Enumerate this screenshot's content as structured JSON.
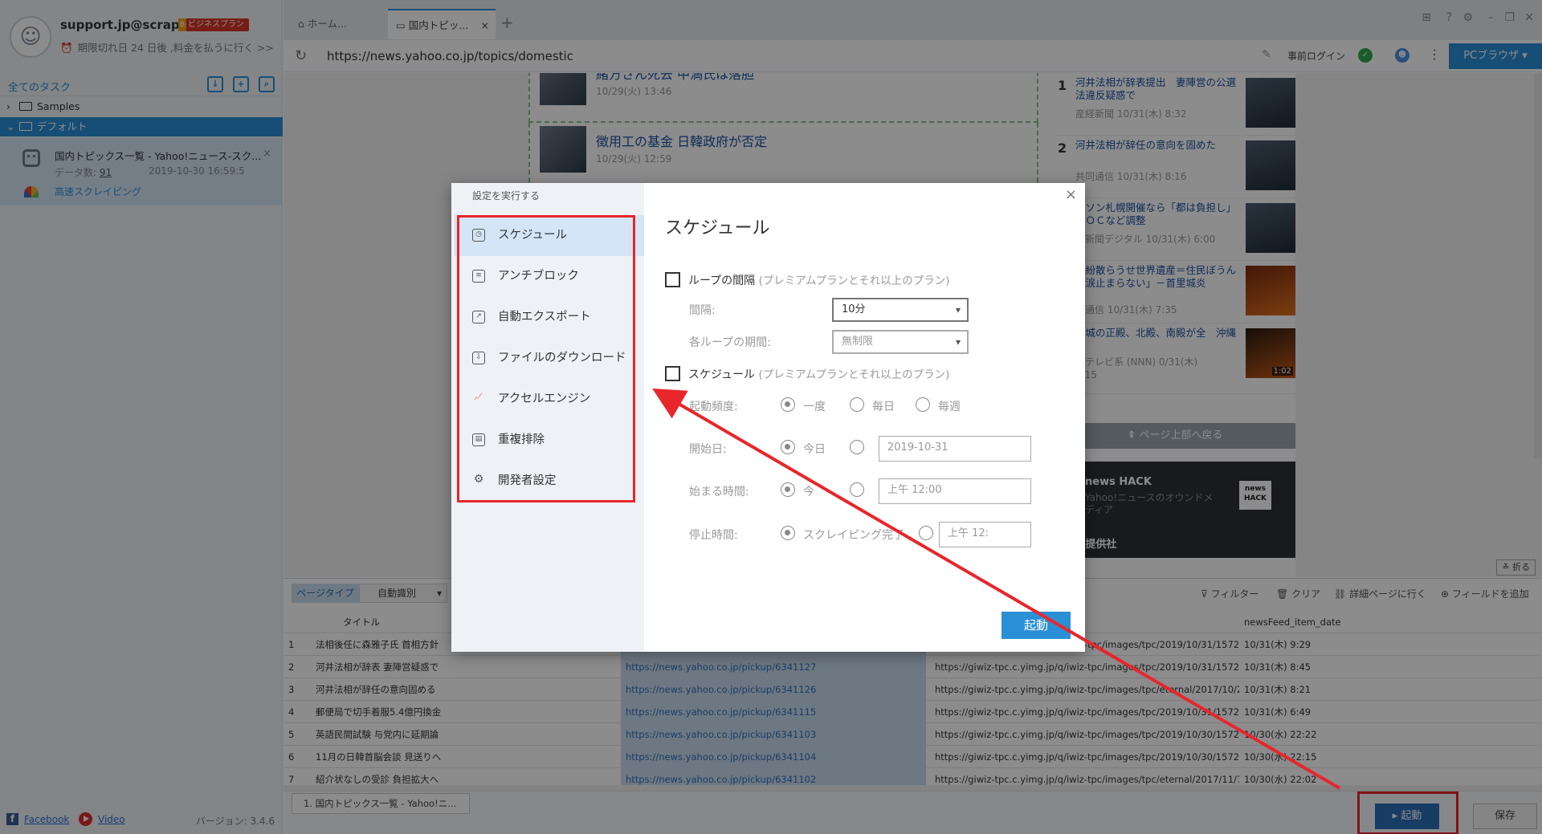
{
  "account": {
    "name": "support.jp@scrap...",
    "plan_badge": "ビジネスプラン",
    "expire_notice": "期限切れ日 24 日後 ,料金を払うに行く >>"
  },
  "tasks": {
    "all_label": "全てのタスク",
    "folders": [
      "Samples",
      "デフォルト"
    ],
    "item": {
      "title": "国内トピックス一覧 - Yahoo!ニュース-スク...",
      "count_label": "データ数: ",
      "count": "91",
      "date": "2019-10-30 16:59:5",
      "speed_label": "高速スクレイピング"
    }
  },
  "footer": {
    "facebook": "Facebook",
    "video": "Video",
    "version": "バージョン: 3.4.6"
  },
  "browser": {
    "tabs": [
      "ホーム...",
      "国内トピッ..."
    ],
    "url": "https://news.yahoo.co.jp/topics/domestic",
    "prelogin": "事前ログイン",
    "pc_browser": "PCブラウザ"
  },
  "news": [
    {
      "title": "緒方さん死去 中満氏は落胆",
      "date": "10/29(火) 13:46"
    },
    {
      "title": "徴用工の基金 日韓政府が否定",
      "date": "10/29(火) 12:59"
    }
  ],
  "ranking": [
    {
      "no": "1",
      "title": "河井法相が辞表提出　妻陣営の公選法違反疑惑で",
      "source": "産経新聞 10/31(木) 8:32"
    },
    {
      "no": "2",
      "title": "河井法相が辞任の意向を固めた",
      "source": "共同通信 10/31(木) 8:16"
    },
    {
      "no": "",
      "title": "ラソン札幌開催なら「都は負担し」 ＩＯＣなど調整",
      "source": "日新聞デジタル 10/31(木) 6:00"
    },
    {
      "no": "",
      "title": "の紛散らうせ世界遺産＝住民ぼうん「涙止まらない」－首里城炎",
      "source": "事通信 10/31(木) 7:35"
    },
    {
      "no": "",
      "title": "里城の正殿、北殿、南殿が全　沖縄",
      "source": "本テレビ系 (NNN) 0/31(木) 7:15",
      "badge": "1:02"
    }
  ],
  "back_top": "ページ上部へ戻る",
  "newshack": {
    "title": "news HACK",
    "sub": "Yahoo!ニュースのオウンドメディア",
    "logo": "news HACK",
    "provider": "ュース提供社"
  },
  "panel": {
    "collapse": "折る",
    "tab_pagetype": "ページタイプ",
    "tab_auto": "自動識別",
    "tools": [
      "フィルター",
      "クリア",
      "詳細ページに行く",
      "フィールドを追加"
    ],
    "columns": [
      "",
      "タイトル",
      "",
      "",
      "newsFeed_item_date"
    ],
    "rows": [
      [
        "1",
        "法相後任に森雅子氏 首相方針",
        "",
        "https://giwiz-tpc.c.yimg.jp/q/iwiz-tpc/images/tpc/2019/10/31/157248...",
        "10/31(木) 9:29"
      ],
      [
        "2",
        "河井法相が辞表 妻陣営疑惑で",
        "https://news.yahoo.co.jp/pickup/6341127",
        "https://giwiz-tpc.c.yimg.jp/q/iwiz-tpc/images/tpc/2019/10/31/157247...",
        "10/31(木) 8:45"
      ],
      [
        "3",
        "河井法相が辞任の意向固める",
        "https://news.yahoo.co.jp/pickup/6341126",
        "https://giwiz-tpc.c.yimg.jp/q/iwiz-tpc/images/tpc/eternal/2017/10/27/...",
        "10/31(木) 8:21"
      ],
      [
        "4",
        "郵便局で切手着服5.4億円換金",
        "https://news.yahoo.co.jp/pickup/6341115",
        "https://giwiz-tpc.c.yimg.jp/q/iwiz-tpc/images/tpc/2019/10/31/157247...",
        "10/31(木) 6:49"
      ],
      [
        "5",
        "英語民間試験 与党内に延期論",
        "https://news.yahoo.co.jp/pickup/6341103",
        "https://giwiz-tpc.c.yimg.jp/q/iwiz-tpc/images/tpc/2019/10/30/157244...",
        "10/30(水) 22:22"
      ],
      [
        "6",
        "11月の日韓首脳会談 見送りへ",
        "https://news.yahoo.co.jp/pickup/6341104",
        "https://giwiz-tpc.c.yimg.jp/q/iwiz-tpc/images/tpc/2019/10/30/157244...",
        "10/30(水) 22:15"
      ],
      [
        "7",
        "紹介状なしの受診 負担拡大へ",
        "https://news.yahoo.co.jp/pickup/6341102",
        "https://giwiz-tpc.c.yimg.jp/q/iwiz-tpc/images/tpc/eternal/2017/11/7/1...",
        "10/30(水) 22:02"
      ]
    ]
  },
  "bottom": {
    "task_tab": "1. 国内トピックス一覧 - Yahoo!ニ...",
    "start": "起動",
    "save": "保存"
  },
  "dialog": {
    "header": "設定を実行する",
    "nav": [
      "スケジュール",
      "アンチブロック",
      "自動エクスポート",
      "ファイルのダウンロード",
      "アクセルエンジン",
      "重複排除",
      "開発者設定"
    ],
    "title": "スケジュール",
    "loop_label": "ループの間隔",
    "loop_note": "(プレミアムプランとそれ以上のプラン)",
    "interval_label": "間隔:",
    "interval_value": "10分",
    "period_label": "各ループの期間:",
    "period_value": "無制限",
    "schedule_label": "スケジュール",
    "schedule_note": "(プレミアムプランとそれ以上のプラン)",
    "freq_label": "起動頻度:",
    "freq_options": [
      "一度",
      "毎日",
      "毎週"
    ],
    "start_date_label": "開始日:",
    "start_date_today": "今日",
    "start_date_value": "2019-10-31",
    "start_time_label": "始まる時間:",
    "start_time_now": "今",
    "start_time_value": "上午 12:00",
    "stop_time_label": "停止時間:",
    "stop_time_option": "スクレイピング完了",
    "stop_time_value": "上午 12:",
    "start_button": "起動"
  },
  "colors": {
    "accent": "#2b8fd6",
    "highlight": "#e8262b"
  }
}
